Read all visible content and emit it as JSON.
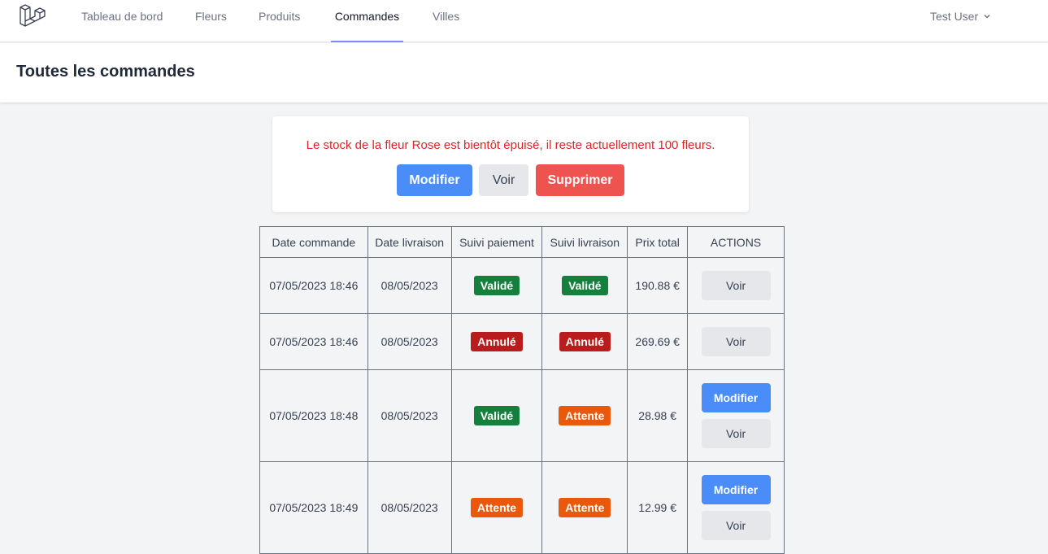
{
  "nav": {
    "links": [
      "Tableau de bord",
      "Fleurs",
      "Produits",
      "Commandes",
      "Villes"
    ],
    "active": "Commandes",
    "user": "Test User"
  },
  "header": {
    "title": "Toutes les commandes"
  },
  "alert": {
    "message": "Le stock de la fleur Rose est bientôt épuisé, il reste actuellement 100 fleurs.",
    "buttons": {
      "edit": "Modifier",
      "view": "Voir",
      "delete": "Supprimer"
    }
  },
  "table": {
    "headers": [
      "Date commande",
      "Date livraison",
      "Suivi paiement",
      "Suivi livraison",
      "Prix total",
      "ACTIONS"
    ],
    "rows": [
      {
        "order_date": "07/05/2023 18:46",
        "delivery_date": "08/05/2023",
        "payment": "Validé",
        "payment_status": "green",
        "delivery": "Validé",
        "delivery_status": "green",
        "total": "190.88 €",
        "actions": [
          "Voir"
        ]
      },
      {
        "order_date": "07/05/2023 18:46",
        "delivery_date": "08/05/2023",
        "payment": "Annulé",
        "payment_status": "red",
        "delivery": "Annulé",
        "delivery_status": "red",
        "total": "269.69 €",
        "actions": [
          "Voir"
        ]
      },
      {
        "order_date": "07/05/2023 18:48",
        "delivery_date": "08/05/2023",
        "payment": "Validé",
        "payment_status": "green",
        "delivery": "Attente",
        "delivery_status": "orange",
        "total": "28.98 €",
        "actions": [
          "Modifier",
          "Voir"
        ]
      },
      {
        "order_date": "07/05/2023 18:49",
        "delivery_date": "08/05/2023",
        "payment": "Attente",
        "payment_status": "orange",
        "delivery": "Attente",
        "delivery_status": "orange",
        "total": "12.99 €",
        "actions": [
          "Modifier",
          "Voir"
        ]
      }
    ]
  },
  "colors": {
    "accent": "#818cf8",
    "primary_button": "#4b8df8",
    "danger_button": "#ef5350",
    "alert_text": "#dc2626",
    "badge_green": "#15803d",
    "badge_red": "#b91c1c",
    "badge_orange": "#ea580c"
  }
}
